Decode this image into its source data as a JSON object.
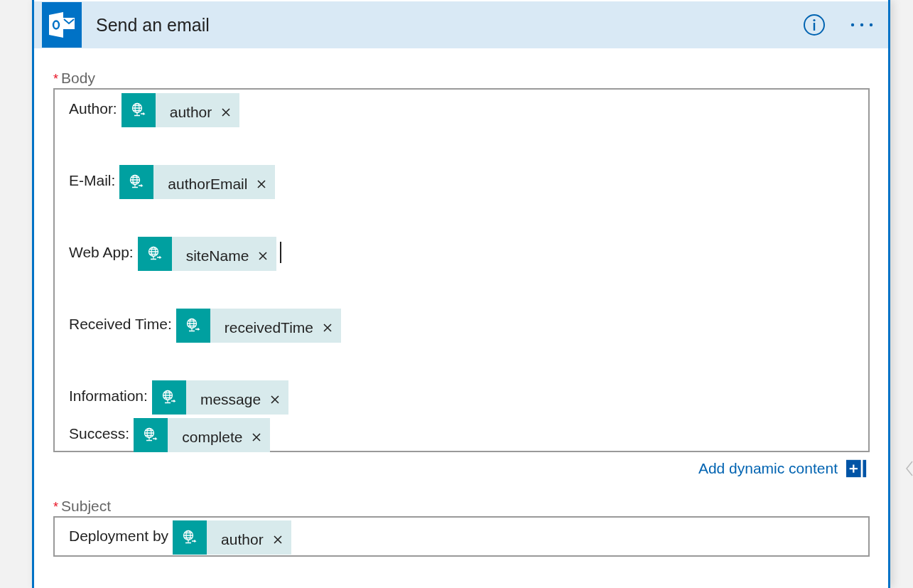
{
  "card": {
    "title": "Send an email"
  },
  "body": {
    "label": "Body",
    "required_mark": "*",
    "lines": [
      {
        "kind": "field",
        "label": "Author:",
        "token": "author",
        "cursor": false
      },
      {
        "kind": "empty"
      },
      {
        "kind": "field",
        "label": "E-Mail:",
        "token": "authorEmail",
        "cursor": false
      },
      {
        "kind": "empty"
      },
      {
        "kind": "field",
        "label": "Web App:",
        "token": "siteName",
        "cursor": true
      },
      {
        "kind": "empty"
      },
      {
        "kind": "field",
        "label": "Received Time:",
        "token": "receivedTime",
        "cursor": false
      },
      {
        "kind": "empty"
      },
      {
        "kind": "field",
        "label": "Information:",
        "token": "message",
        "cursor": false
      },
      {
        "kind": "field",
        "label": "Success:",
        "token": "complete",
        "cursor": false
      }
    ]
  },
  "add_dynamic_content": "Add dynamic content",
  "subject": {
    "label": "Subject",
    "required_mark": "*",
    "text": "Deployment by",
    "token": "author"
  }
}
